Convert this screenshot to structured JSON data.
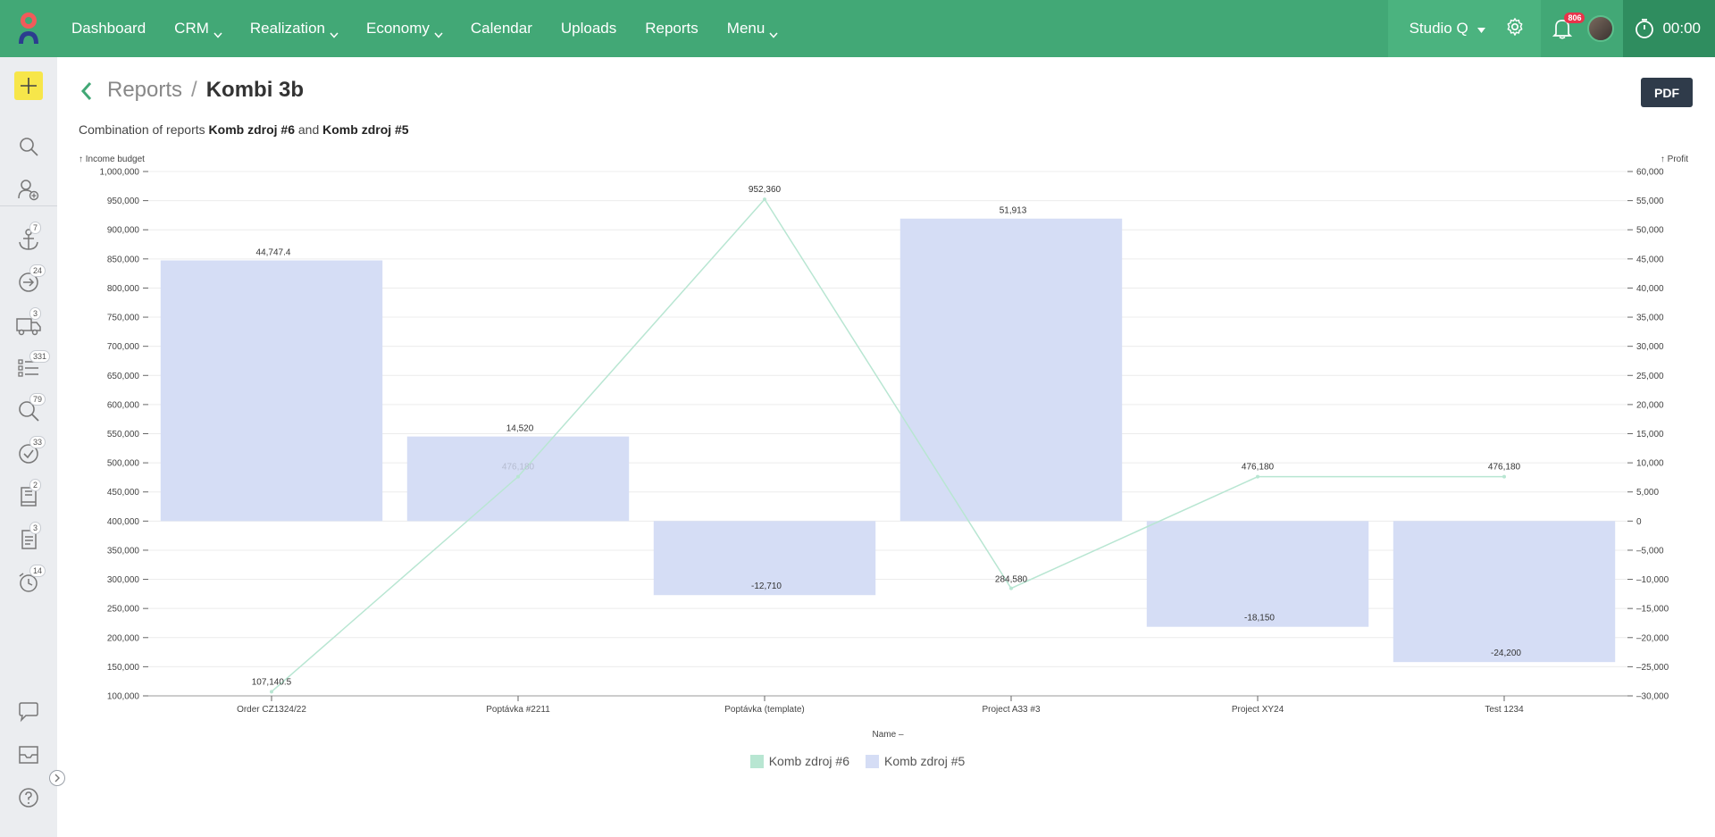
{
  "nav": {
    "items": [
      {
        "label": "Dashboard",
        "dropdown": false
      },
      {
        "label": "CRM",
        "dropdown": true
      },
      {
        "label": "Realization",
        "dropdown": true
      },
      {
        "label": "Economy",
        "dropdown": true
      },
      {
        "label": "Calendar",
        "dropdown": false
      },
      {
        "label": "Uploads",
        "dropdown": false
      },
      {
        "label": "Reports",
        "dropdown": false
      },
      {
        "label": "Menu",
        "dropdown": true
      }
    ],
    "studio": "Studio Q",
    "notifications": "806",
    "timer": "00:00"
  },
  "sidebar": {
    "badges": [
      "7",
      "24",
      "3",
      "331",
      "79",
      "33",
      "2",
      "3",
      "14"
    ]
  },
  "header": {
    "breadcrumb_parent": "Reports",
    "breadcrumb_sep": "/",
    "title": "Kombi 3b",
    "pdf": "PDF",
    "subtitle_prefix": "Combination of reports",
    "source_a": "Komb zdroj #6",
    "subtitle_and": "and",
    "source_b": "Komb zdroj #5"
  },
  "colors": {
    "topbar": "#42a876",
    "bar": "#d5ddf5",
    "line": "#b8e6d2"
  },
  "chart_data": {
    "type": "bar",
    "categories": [
      "Order CZ1324/22",
      "Poptávka #2211",
      "Poptávka (template)",
      "Project A33 #3",
      "Project XY24",
      "Test 1234"
    ],
    "xlabel": "Name –",
    "ylabel_left": "↑ Income budget",
    "ylabel_right": "↑ Profit",
    "ylim_left": [
      100000,
      1000000
    ],
    "ylim_right": [
      -30000,
      60000
    ],
    "left_ticks": [
      "1,000,000",
      "950,000",
      "900,000",
      "850,000",
      "800,000",
      "750,000",
      "700,000",
      "650,000",
      "600,000",
      "550,000",
      "500,000",
      "450,000",
      "400,000",
      "350,000",
      "300,000",
      "250,000",
      "200,000",
      "150,000",
      "100,000"
    ],
    "right_ticks": [
      "60,000",
      "55,000",
      "50,000",
      "45,000",
      "40,000",
      "35,000",
      "30,000",
      "25,000",
      "20,000",
      "15,000",
      "10,000",
      "5,000",
      "0",
      "–5,000",
      "–10,000",
      "–15,000",
      "–20,000",
      "–25,000",
      "–30,000"
    ],
    "series": [
      {
        "name": "Komb zdroj #6",
        "kind": "line",
        "axis": "left",
        "values": [
          107140.5,
          476180,
          952360,
          284580,
          476180,
          476180
        ],
        "labels": [
          "107,140.5",
          "476,180",
          "952,360",
          "284,580",
          "476,180",
          "476,180"
        ]
      },
      {
        "name": "Komb zdroj #5",
        "kind": "bar",
        "axis": "right",
        "values": [
          44747.4,
          14520,
          -12710,
          51913,
          -18150,
          -24200
        ],
        "labels": [
          "44,747.4",
          "14,520",
          "-12,710",
          "51,913",
          "-18,150",
          "-24,200"
        ]
      }
    ],
    "legend": "bottom-center",
    "grid": true
  }
}
